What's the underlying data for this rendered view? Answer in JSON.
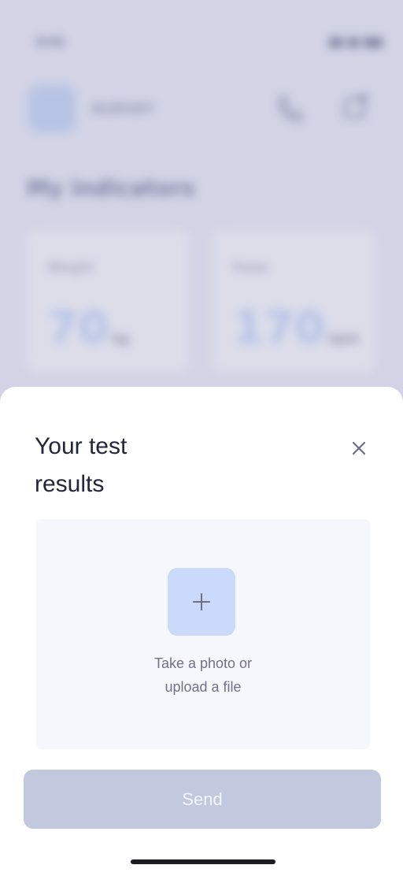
{
  "background": {
    "status_time": "9:41",
    "user_name": "ALEKSEY",
    "section_title": "My indicators",
    "cards": [
      {
        "label": "Weight",
        "value": "70",
        "unit": "kg"
      },
      {
        "label": "Pulse",
        "value": "170",
        "unit": "bpm"
      }
    ]
  },
  "sheet": {
    "title_line1": "Your test",
    "title_line2": "results",
    "close_icon": "close-icon",
    "upload": {
      "icon": "plus-icon",
      "line1": "Take a photo or",
      "line2": "upload a file"
    },
    "send_label": "Send"
  },
  "colors": {
    "accent_light": "#cbdafa",
    "button_disabled": "#c2c8dd",
    "title_text": "#24253a"
  }
}
